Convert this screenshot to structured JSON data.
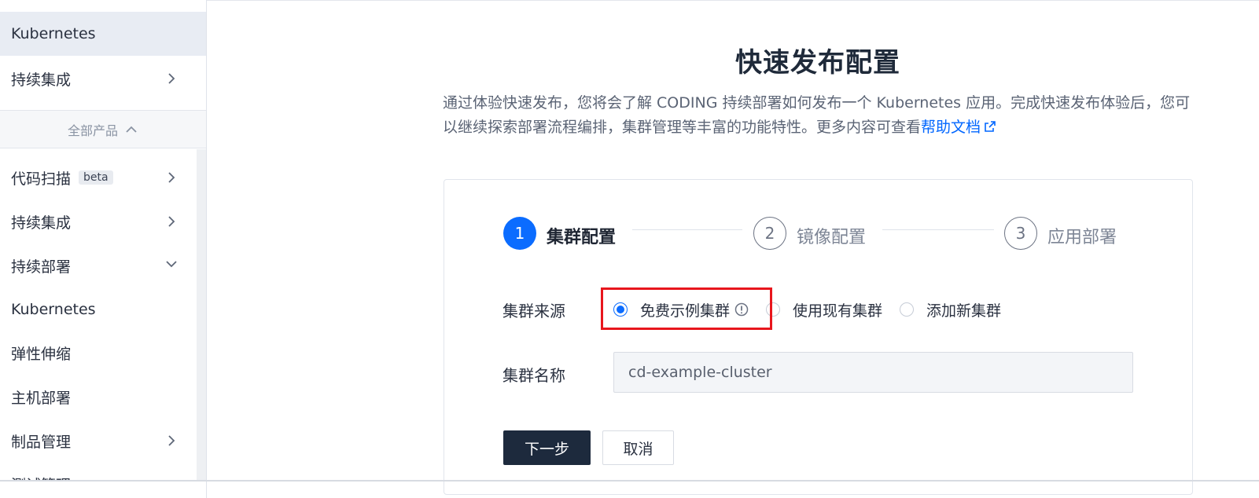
{
  "sidebar": {
    "items_top": [
      {
        "label": "Kubernetes",
        "active": true,
        "chevron": "none"
      },
      {
        "label": "持续集成",
        "chevron": "right"
      }
    ],
    "group_label": "全部产品",
    "items": [
      {
        "label": "代码扫描",
        "badge": "beta",
        "chevron": "right"
      },
      {
        "label": "持续集成",
        "chevron": "right"
      },
      {
        "label": "持续部署",
        "chevron": "down"
      },
      {
        "label": "Kubernetes",
        "chevron": "none"
      },
      {
        "label": "弹性伸缩",
        "chevron": "none"
      },
      {
        "label": "主机部署",
        "chevron": "none"
      },
      {
        "label": "制品管理",
        "chevron": "right"
      },
      {
        "label": "测试管理",
        "chevron": "down"
      }
    ]
  },
  "main": {
    "title": "快速发布配置",
    "desc_text": "通过体验快速发布，您将会了解 CODING 持续部署如何发布一个 Kubernetes 应用。完成快速发布体验后，您可以继续探索部署流程编排，集群管理等丰富的功能特性。更多内容可查看",
    "desc_link": "帮助文档",
    "steps": [
      {
        "number": "1",
        "label": "集群配置",
        "state": "current"
      },
      {
        "number": "2",
        "label": "镜像配置",
        "state": "todo"
      },
      {
        "number": "3",
        "label": "应用部署",
        "state": "todo"
      }
    ],
    "form": {
      "source_label": "集群来源",
      "options": [
        "免费示例集群",
        "使用现有集群",
        "添加新集群"
      ],
      "selected_option": "免费示例集群",
      "name_label": "集群名称",
      "name_value": "cd-example-cluster"
    },
    "buttons": {
      "next": "下一步",
      "cancel": "取消"
    }
  },
  "colors": {
    "accent": "#0b6cff",
    "primary_button": "#1d2a3d",
    "highlight": "#e8161d"
  }
}
